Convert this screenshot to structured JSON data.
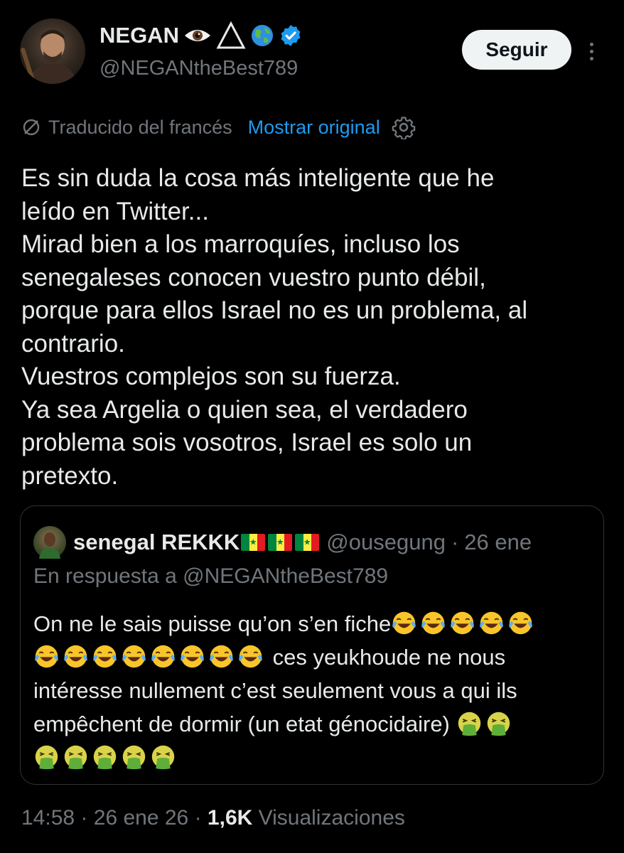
{
  "author": {
    "name": "NEGAN",
    "handle": "@NEGANtheBest789",
    "verified": true
  },
  "actions": {
    "follow_label": "Seguir"
  },
  "translation": {
    "notice": "Traducido del francés",
    "show_original": "Mostrar original"
  },
  "tweet": {
    "lines": [
      "Es sin duda la cosa más inteligente que he",
      "leído en Twitter...",
      "Mirad bien a los marroquíes, incluso los",
      "senegaleses conocen vuestro punto débil,",
      "porque para ellos Israel no es un problema, al",
      "contrario.",
      "Vuestros complejos son su fuerza.",
      "Ya sea Argelia o quien sea, el verdadero",
      "problema sois vosotros, Israel es solo un",
      "pretexto."
    ]
  },
  "quoted_tweet": {
    "name": "senegal REKKK",
    "handle": "@ousegung",
    "date": "26 ene",
    "reply_to": "En respuesta a @NEGANtheBest789",
    "line1": "On ne le sais puisse qu’on s’en fiche",
    "line2": " ces yeukhoude ne nous",
    "line3": "intéresse nullement c’est seulement vous a qui ils",
    "line4": "empêchent de dormir (un etat génocidaire) "
  },
  "footer": {
    "time": "14:58",
    "date": "26 ene 26",
    "views_count": "1,6K",
    "views_label": "Visualizaciones",
    "separator": "·"
  },
  "colors": {
    "background": "#000000",
    "text": "#e7e9ea",
    "secondary": "#71767b",
    "link": "#1d9bf0",
    "verified": "#1d9bf0",
    "border": "#2f3336",
    "button_bg": "#eff3f4"
  }
}
